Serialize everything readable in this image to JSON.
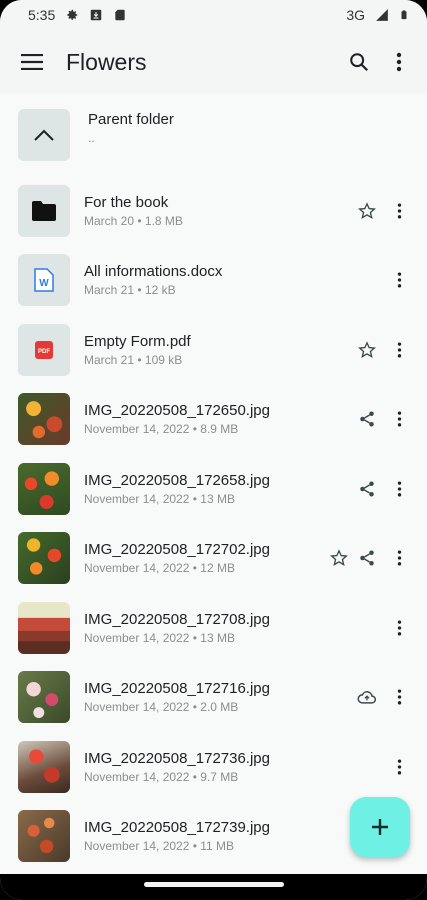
{
  "status_bar": {
    "time": "5:35",
    "network": "3G"
  },
  "app_bar": {
    "title": "Flowers"
  },
  "parent": {
    "label": "Parent folder",
    "sub": ".."
  },
  "files": [
    {
      "name": "For the book",
      "meta": "March 20 • 1.8 MB",
      "type": "folder"
    },
    {
      "name": "All informations.docx",
      "meta": "March 21 • 12 kB",
      "type": "docx"
    },
    {
      "name": "Empty Form.pdf",
      "meta": "March 21 • 109 kB",
      "type": "pdf"
    },
    {
      "name": "IMG_20220508_172650.jpg",
      "meta": "November 14, 2022 • 8.9 MB",
      "type": "image"
    },
    {
      "name": "IMG_20220508_172658.jpg",
      "meta": "November 14, 2022 • 13 MB",
      "type": "image"
    },
    {
      "name": "IMG_20220508_172702.jpg",
      "meta": "November 14, 2022 • 12 MB",
      "type": "image"
    },
    {
      "name": "IMG_20220508_172708.jpg",
      "meta": "November 14, 2022 • 13 MB",
      "type": "image"
    },
    {
      "name": "IMG_20220508_172716.jpg",
      "meta": "November 14, 2022 • 2.0 MB",
      "type": "image"
    },
    {
      "name": "IMG_20220508_172736.jpg",
      "meta": "November 14, 2022 • 9.7 MB",
      "type": "image"
    },
    {
      "name": "IMG_20220508_172739.jpg",
      "meta": "November 14, 2022 • 11 MB",
      "type": "image"
    }
  ],
  "colors": {
    "accent": "#6ef0e4",
    "thumb_bg": "#dde6e4",
    "icon": "#3c4a4c"
  }
}
